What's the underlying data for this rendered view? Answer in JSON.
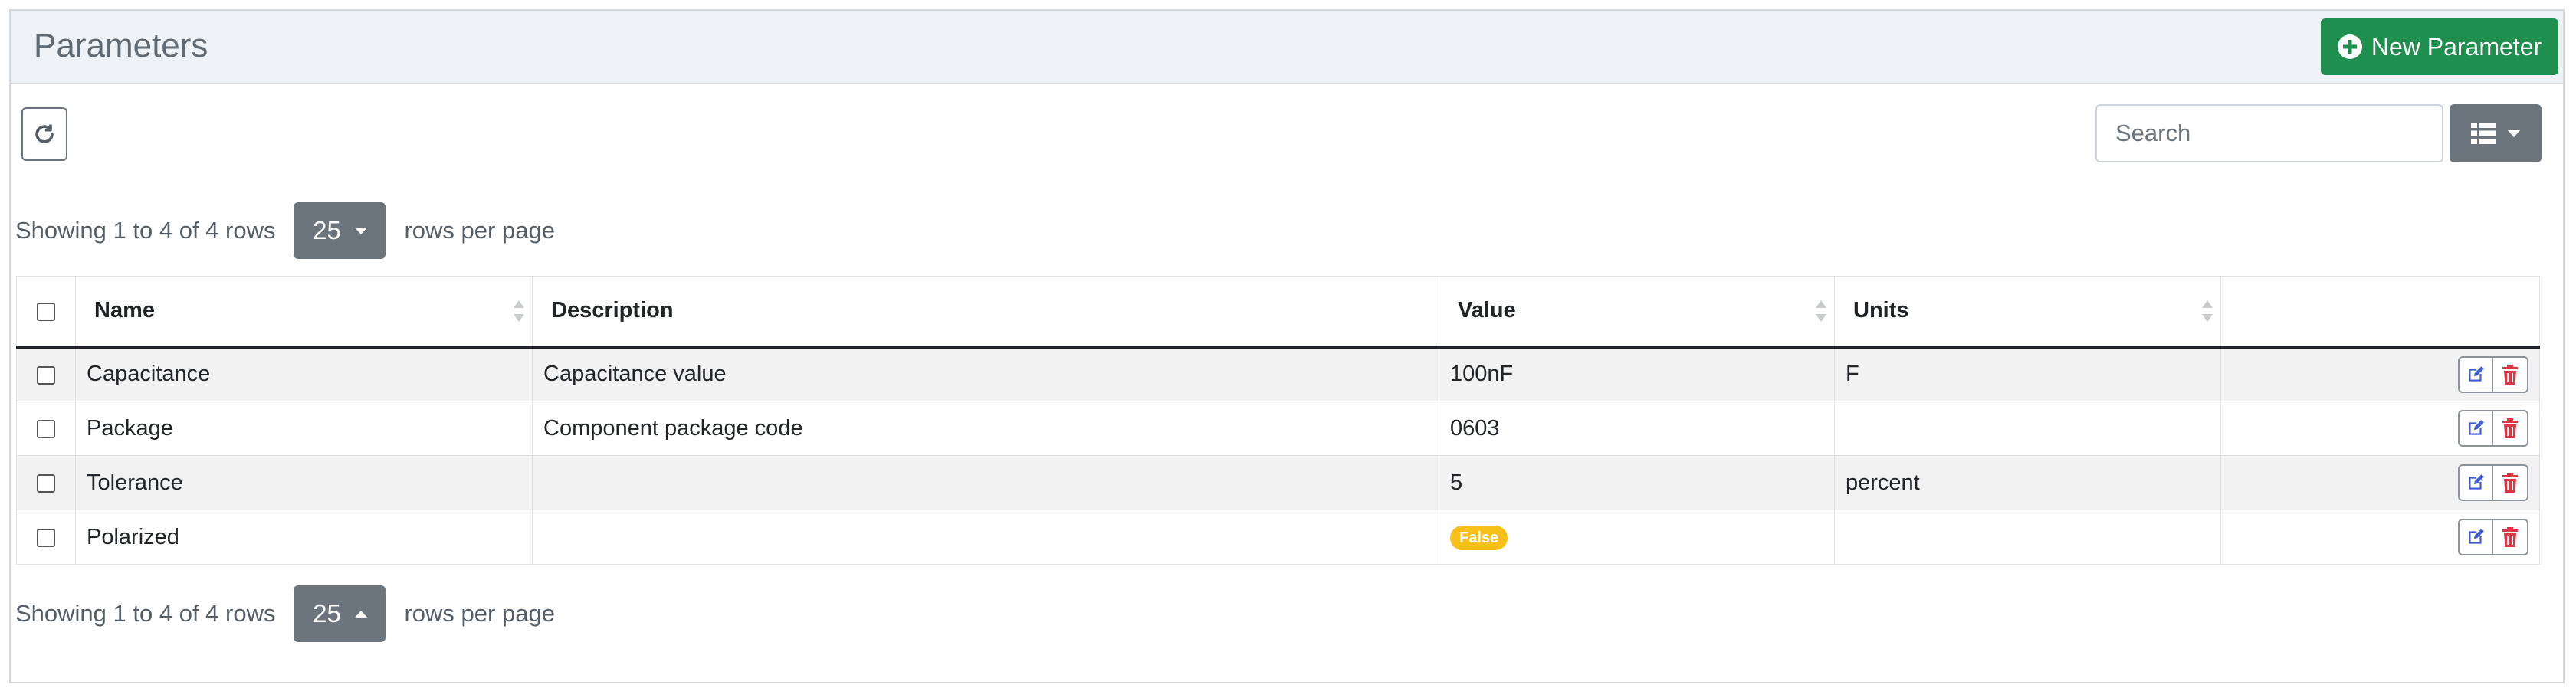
{
  "header": {
    "title": "Parameters",
    "new_button_label": "New Parameter"
  },
  "toolbar": {
    "search_placeholder": "Search"
  },
  "pagination": {
    "summary": "Showing 1 to 4 of 4 rows",
    "page_size": "25",
    "rows_per_page_label": "rows per page"
  },
  "table": {
    "columns": [
      "Name",
      "Description",
      "Value",
      "Units"
    ],
    "rows": [
      {
        "name": "Capacitance",
        "description": "Capacitance value",
        "value": "100nF",
        "units": "F"
      },
      {
        "name": "Package",
        "description": "Component package code",
        "value": "0603",
        "units": ""
      },
      {
        "name": "Tolerance",
        "description": "",
        "value": "5",
        "units": "percent"
      },
      {
        "name": "Polarized",
        "description": "",
        "value": "False",
        "units": "",
        "value_is_badge": true
      }
    ]
  },
  "colors": {
    "primary_success": "#1e8f4e",
    "secondary": "#6c757d",
    "badge_warning": "#f7c019",
    "edit_icon": "#3d5bd6",
    "delete_icon": "#dc3545"
  },
  "icons": {
    "new": "plus-circle-icon",
    "refresh": "refresh-icon",
    "view": "list-view-icon",
    "edit": "edit-icon",
    "delete": "trash-icon"
  }
}
